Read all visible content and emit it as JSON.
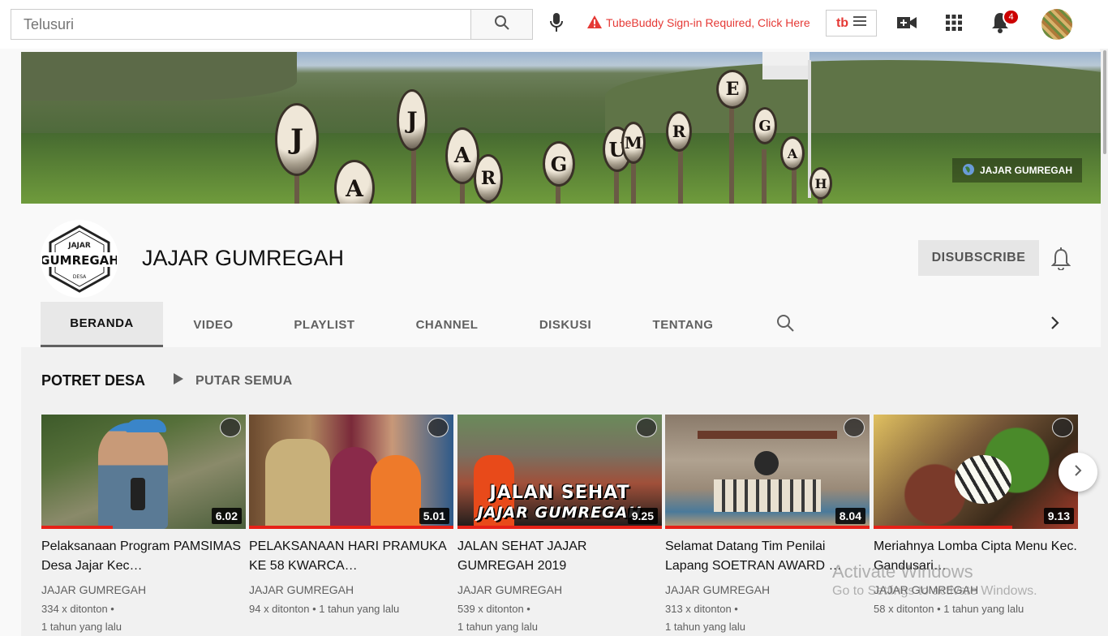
{
  "topbar": {
    "search_placeholder": "Telusuri",
    "tubebuddy_warning": "TubeBuddy Sign-in Required, Click Here",
    "tubebuddy_logo": "tb",
    "notifications_count": "4",
    "icons": [
      "search-icon",
      "mic-icon",
      "warning-icon",
      "menu-icon",
      "create-video-icon",
      "apps-icon",
      "bell-icon"
    ]
  },
  "banner": {
    "link_label": "JAJAR GUMREGAH",
    "letters": [
      "J",
      "A",
      "J",
      "A",
      "R",
      "G",
      "U",
      "M",
      "R",
      "E",
      "G",
      "A",
      "H"
    ]
  },
  "channel": {
    "name": "JAJAR GUMREGAH",
    "logo_top": "JAJAR",
    "logo_main": "GUMREGAH",
    "logo_sub": "DESA",
    "unsubscribe_label": "DISUBSCRIBE"
  },
  "tabs": [
    {
      "label": "BERANDA",
      "active": true
    },
    {
      "label": "VIDEO"
    },
    {
      "label": "PLAYLIST"
    },
    {
      "label": "CHANNEL"
    },
    {
      "label": "DISKUSI"
    },
    {
      "label": "TENTANG"
    }
  ],
  "section": {
    "title": "POTRET DESA",
    "play_all": "PUTAR SEMUA"
  },
  "videos": [
    {
      "title": "Pelaksanaan Program PAMSIMAS Desa Jajar Kec…",
      "duration": "6.02",
      "channel": "JAJAR GUMREGAH",
      "views": "334 x ditonton",
      "age": "1 tahun yang lalu",
      "progress": 0.35
    },
    {
      "title": "PELAKSANAAN HARI PRAMUKA KE 58 KWARCA…",
      "duration": "5.01",
      "channel": "JAJAR GUMREGAH",
      "views": "94 x ditonton",
      "age": "1 tahun yang lalu",
      "progress": 1.0
    },
    {
      "title": "JALAN SEHAT JAJAR GUMREGAH 2019",
      "duration": "9.25",
      "channel": "JAJAR GUMREGAH",
      "views": "539 x ditonton",
      "age": "1 tahun yang lalu",
      "progress": 1.0,
      "overlay_line1": "JALAN SEHAT",
      "overlay_line2": "JAJAR GUMREGAH"
    },
    {
      "title": "Selamat Datang Tim Penilai Lapang SOETRAN AWARD …",
      "duration": "8.04",
      "channel": "JAJAR GUMREGAH",
      "views": "313 x ditonton",
      "age": "1 tahun yang lalu",
      "progress": 1.0
    },
    {
      "title": "Meriahnya Lomba Cipta Menu Kec. Gandusari…",
      "duration": "9.13",
      "channel": "JAJAR GUMREGAH",
      "views": "58 x ditonton",
      "age": "1 tahun yang lalu",
      "progress": 0.68
    }
  ],
  "watermark": {
    "line1": "Activate Windows",
    "line2": "Go to Settings to activate Windows."
  }
}
